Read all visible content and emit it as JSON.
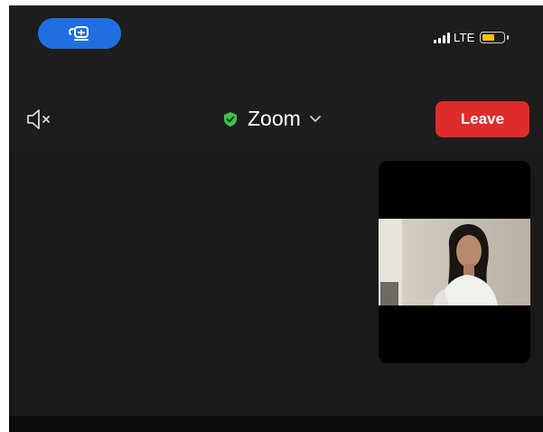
{
  "status_bar": {
    "call_pill_icon": "screen-share-icon",
    "network_label": "LTE",
    "signal_icon": "cellular-signal-icon",
    "battery_icon": "battery-icon",
    "colors": {
      "pill": "#1f6fe0",
      "battery": "#f6c400"
    }
  },
  "toolbar": {
    "audio_icon": "speaker-muted-icon",
    "security_icon": "shield-check-icon",
    "meeting_title": "Zoom",
    "dropdown_icon": "chevron-down-icon",
    "leave_label": "Leave",
    "colors": {
      "leave": "#e02b2b",
      "shield": "#3cc34a"
    }
  },
  "video": {
    "participant_tile": "participant-video-thumbnail"
  }
}
